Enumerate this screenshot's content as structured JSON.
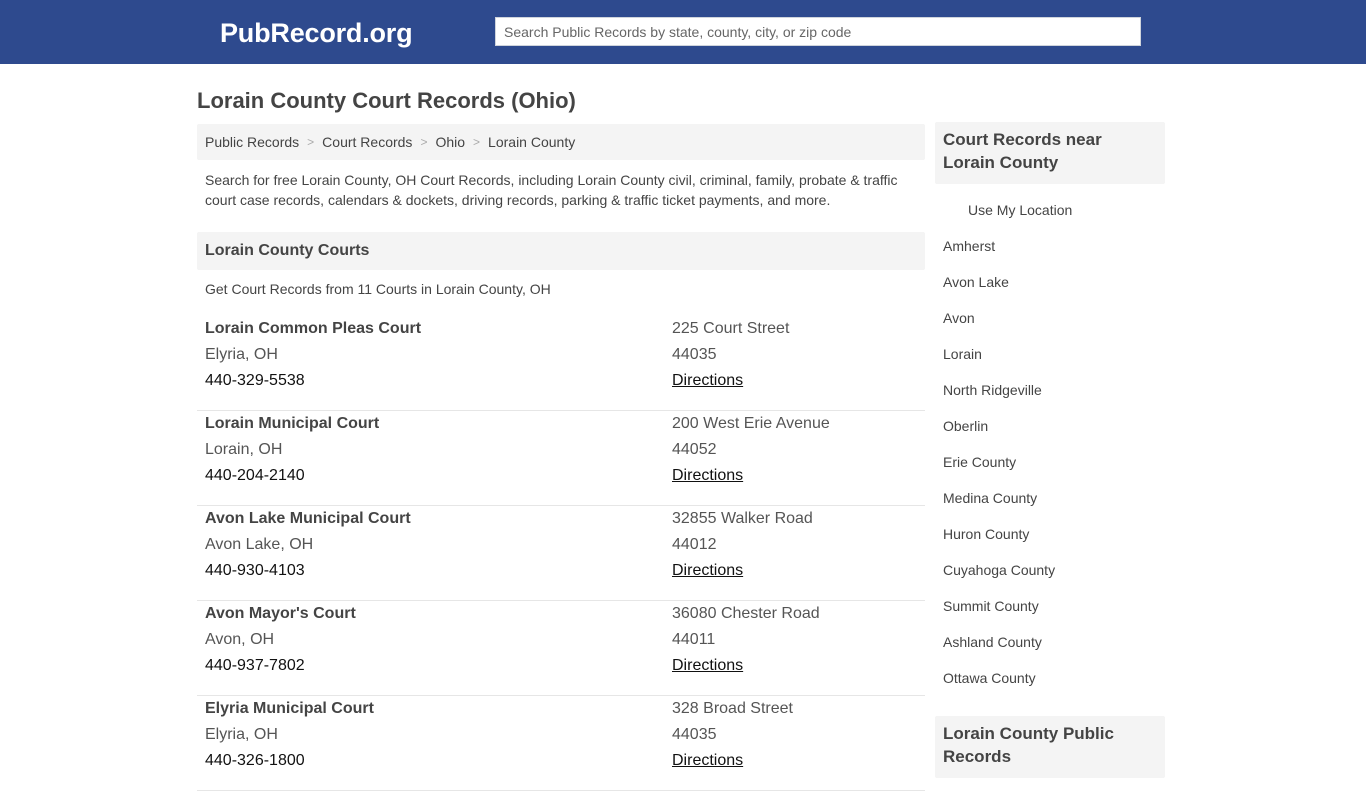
{
  "header": {
    "logo": "PubRecord.org",
    "search_placeholder": "Search Public Records by state, county, city, or zip code"
  },
  "page_title": "Lorain County Court Records (Ohio)",
  "breadcrumb": [
    "Public Records",
    "Court Records",
    "Ohio",
    "Lorain County"
  ],
  "intro": "Search for free Lorain County, OH Court Records, including Lorain County civil, criminal, family, probate & traffic court case records, calendars & dockets, driving records, parking & traffic ticket payments, and more.",
  "courts_section": {
    "title": "Lorain County Courts",
    "subtitle": "Get Court Records from 11 Courts in Lorain County, OH",
    "directions_label": "Directions",
    "courts": [
      {
        "name": "Lorain Common Pleas Court",
        "city": "Elyria, OH",
        "phone": "440-329-5538",
        "street": "225 Court Street",
        "zip": "44035"
      },
      {
        "name": "Lorain Municipal Court",
        "city": "Lorain, OH",
        "phone": "440-204-2140",
        "street": "200 West Erie Avenue",
        "zip": "44052"
      },
      {
        "name": "Avon Lake Municipal Court",
        "city": "Avon Lake, OH",
        "phone": "440-930-4103",
        "street": "32855 Walker Road",
        "zip": "44012"
      },
      {
        "name": "Avon Mayor's Court",
        "city": "Avon, OH",
        "phone": "440-937-7802",
        "street": "36080 Chester Road",
        "zip": "44011"
      },
      {
        "name": "Elyria Municipal Court",
        "city": "Elyria, OH",
        "phone": "440-326-1800",
        "street": "328 Broad Street",
        "zip": "44035"
      }
    ]
  },
  "sidebar": {
    "nearby_title": "Court Records near Lorain County",
    "use_location": "Use My Location",
    "nearby": [
      "Amherst",
      "Avon Lake",
      "Avon",
      "Lorain",
      "North Ridgeville",
      "Oberlin",
      "Erie County",
      "Medina County",
      "Huron County",
      "Cuyahoga County",
      "Summit County",
      "Ashland County",
      "Ottawa County"
    ],
    "public_records_title": "Lorain County Public Records"
  }
}
